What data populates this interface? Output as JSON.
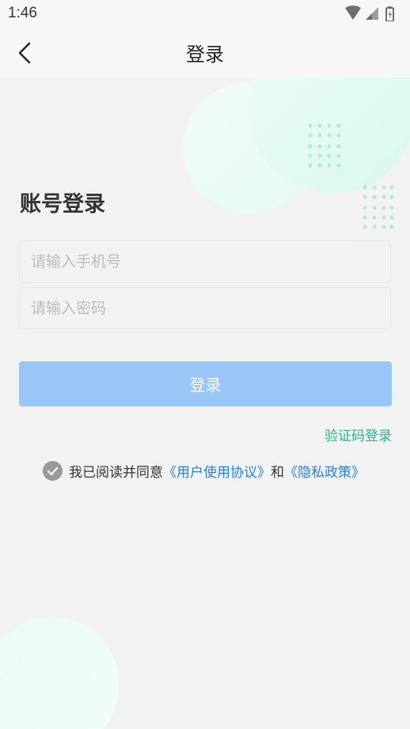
{
  "status_bar": {
    "time": "1:46",
    "icons": [
      "wifi-icon",
      "signal-icon",
      "battery-icon"
    ]
  },
  "header": {
    "back_icon": "chevron-left-icon",
    "title": "登录"
  },
  "form": {
    "heading": "账号登录",
    "phone_placeholder": "请输入手机号",
    "password_placeholder": "请输入密码",
    "login_button": "登录",
    "sms_login_link": "验证码登录"
  },
  "agreement": {
    "checked": true,
    "prefix": "我已阅读并同意",
    "user_agreement": "《用户使用协议》",
    "conjunction": "和",
    "privacy_policy": "《隐私政策》"
  },
  "colors": {
    "accent_green": "#2ab58e",
    "link_blue": "#2b84d9",
    "button_blue": "#97c6f7",
    "decor_mint": "#e3fbf3"
  }
}
